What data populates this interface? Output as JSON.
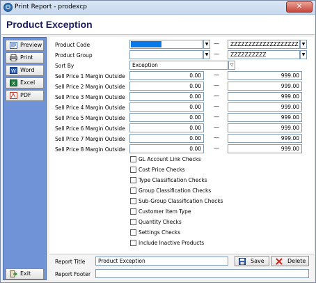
{
  "window": {
    "title": "Print Report - prodexcp",
    "close_label": "✕"
  },
  "header": {
    "title": "Product Exception"
  },
  "sidebar": {
    "buttons": [
      {
        "label": "Preview",
        "icon": "preview-icon"
      },
      {
        "label": "Print",
        "icon": "printer-icon"
      },
      {
        "label": "Word",
        "icon": "word-icon"
      },
      {
        "label": "Excel",
        "icon": "excel-icon"
      },
      {
        "label": "PDF",
        "icon": "pdf-icon"
      }
    ],
    "exit_label": "Exit"
  },
  "form": {
    "product_code": {
      "label": "Product Code",
      "from": "",
      "to": "ZZZZZZZZZZZZZZZZZZZ"
    },
    "product_group": {
      "label": "Product Group",
      "from": "",
      "to": "ZZZZZZZZZZ"
    },
    "sort_by": {
      "label": "Sort By",
      "value": "Exception"
    },
    "range_separator": "—",
    "margins": [
      {
        "label": "Sell Price 1 Margin Outside",
        "from": "0.00",
        "to": "999.00"
      },
      {
        "label": "Sell Price 2 Margin Outside",
        "from": "0.00",
        "to": "999.00"
      },
      {
        "label": "Sell Price 3 Margin Outside",
        "from": "0.00",
        "to": "999.00"
      },
      {
        "label": "Sell Price 4 Margin Outside",
        "from": "0.00",
        "to": "999.00"
      },
      {
        "label": "Sell Price 5 Margin Outside",
        "from": "0.00",
        "to": "999.00"
      },
      {
        "label": "Sell Price 6 Margin Outside",
        "from": "0.00",
        "to": "999.00"
      },
      {
        "label": "Sell Price 7 Margin Outside",
        "from": "0.00",
        "to": "999.00"
      },
      {
        "label": "Sell Price 8 Margin Outside",
        "from": "0.00",
        "to": "999.00"
      }
    ],
    "checks": [
      "GL Account Link Checks",
      "Cost Price Checks",
      "Type Classification Checks",
      "Group Classification Checks",
      "Sub-Group Classification Checks",
      "Customer Item Type",
      "Quantity Checks",
      "Settings Checks",
      "Include Inactive Products"
    ]
  },
  "footer": {
    "report_title_label": "Report Title",
    "report_title_value": "Product Exception",
    "report_footer_label": "Report Footer",
    "report_footer_value": "",
    "save_label": "Save",
    "delete_label": "Delete"
  },
  "colors": {
    "sidebar": "#6f93d6",
    "selection": "#0a78e6",
    "header_text": "#1a1a5e"
  }
}
